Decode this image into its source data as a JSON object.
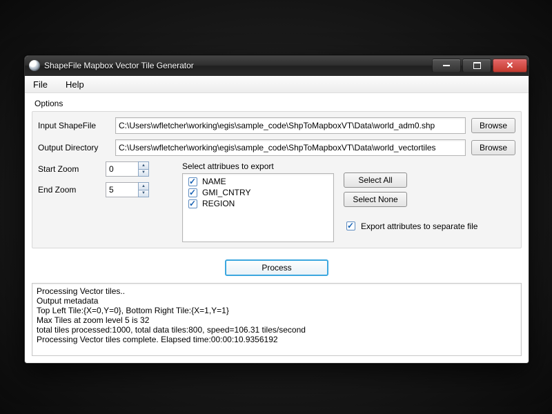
{
  "window": {
    "title": "ShapeFile Mapbox Vector Tile Generator"
  },
  "menu": {
    "file": "File",
    "help": "Help"
  },
  "options": {
    "label": "Options",
    "input_shapefile_label": "Input ShapeFile",
    "input_shapefile_value": "C:\\Users\\wfletcher\\working\\egis\\sample_code\\ShpToMapboxVT\\Data\\world_adm0.shp",
    "output_dir_label": "Output Directory",
    "output_dir_value": "C:\\Users\\wfletcher\\working\\egis\\sample_code\\ShpToMapboxVT\\Data\\world_vectortiles",
    "browse_label": "Browse",
    "start_zoom_label": "Start Zoom",
    "start_zoom_value": "0",
    "end_zoom_label": "End Zoom",
    "end_zoom_value": "5",
    "attributes_label": "Select attribues to export",
    "attributes": [
      "NAME",
      "GMI_CNTRY",
      "REGION"
    ],
    "select_all_label": "Select All",
    "select_none_label": "Select None",
    "export_check_label": "Export attributes to separate file"
  },
  "process_label": "Process",
  "log": "Processing Vector tiles..\nOutput metadata\nTop Left Tile:{X=0,Y=0}, Bottom Right Tile:{X=1,Y=1}\nMax Tiles at zoom level 5 is 32\ntotal tiles processed:1000, total data tiles:800, speed=106.31 tiles/second\nProcessing Vector tiles complete. Elapsed time:00:00:10.9356192"
}
